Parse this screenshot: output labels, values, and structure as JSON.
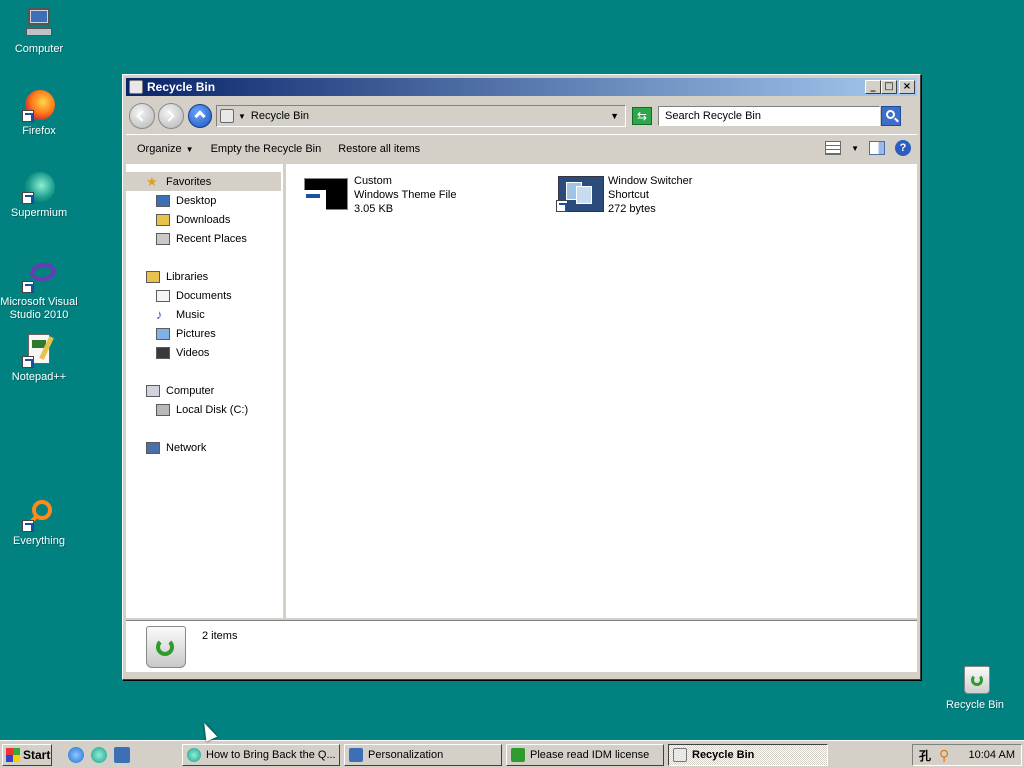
{
  "desktop": {
    "icons": [
      {
        "label": "Computer"
      },
      {
        "label": "Firefox"
      },
      {
        "label": "Supermium"
      },
      {
        "label": "Microsoft Visual Studio 2010"
      },
      {
        "label": "Notepad++"
      },
      {
        "label": "Everything"
      },
      {
        "label": "Recycle Bin"
      }
    ]
  },
  "window": {
    "title": "Recycle Bin",
    "address": "Recycle Bin",
    "search_placeholder": "Search Recycle Bin",
    "commands": {
      "organize": "Organize",
      "empty": "Empty the Recycle Bin",
      "restore": "Restore all items"
    },
    "nav": {
      "favorites": "Favorites",
      "desktop": "Desktop",
      "downloads": "Downloads",
      "recent": "Recent Places",
      "libraries": "Libraries",
      "documents": "Documents",
      "music": "Music",
      "pictures": "Pictures",
      "videos": "Videos",
      "computer": "Computer",
      "local_disk": "Local Disk (C:)",
      "network": "Network"
    },
    "files": [
      {
        "name": "Custom",
        "type": "Windows Theme File",
        "size": "3.05 KB"
      },
      {
        "name": "Window Switcher",
        "type": "Shortcut",
        "size": "272 bytes"
      }
    ],
    "details": {
      "count": "2 items"
    }
  },
  "taskbar": {
    "start": "Start",
    "tasks": [
      {
        "label": "How to Bring Back the Q..."
      },
      {
        "label": "Personalization"
      },
      {
        "label": "Please read IDM license"
      },
      {
        "label": "Recycle Bin"
      }
    ],
    "clock": "10:04 AM"
  }
}
